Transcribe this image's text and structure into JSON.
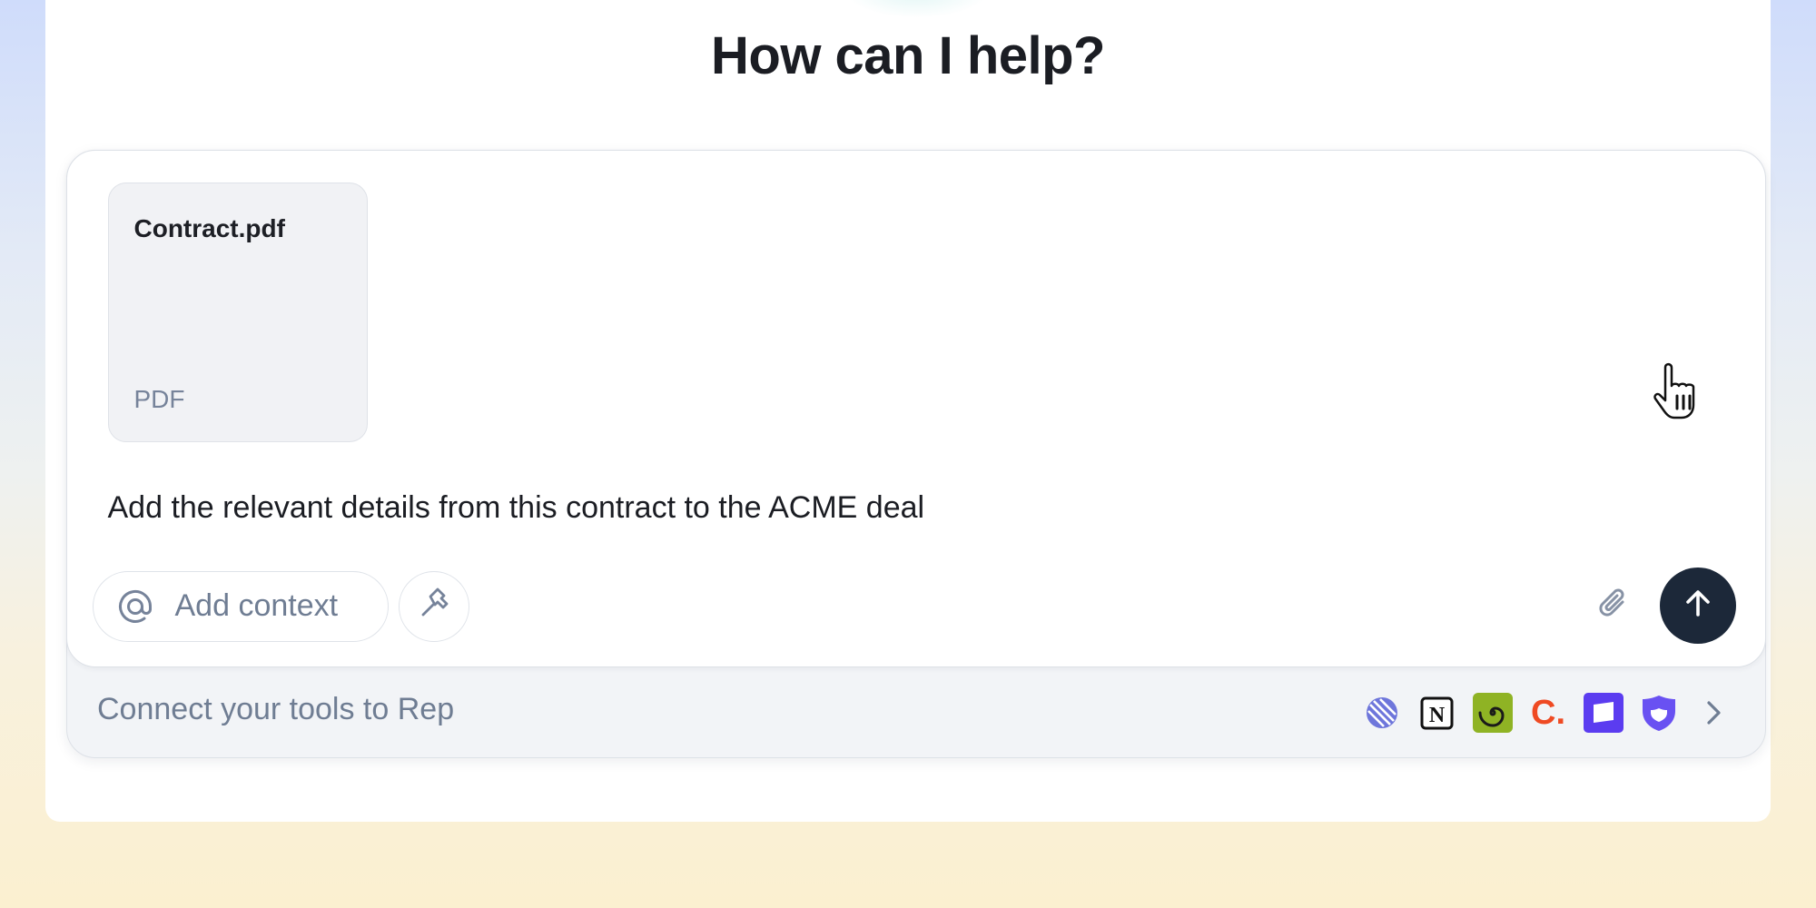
{
  "page": {
    "title": "How can I help?"
  },
  "composer": {
    "attachment": {
      "name": "Contract.pdf",
      "type": "PDF"
    },
    "prompt": "Add the relevant details from this contract to the ACME deal",
    "context_button": {
      "label": "Add context",
      "icon": "at-sign-icon"
    },
    "tools_button": {
      "icon": "hammer-icon"
    },
    "attach_button": {
      "icon": "paperclip-icon"
    },
    "send_button": {
      "icon": "arrow-up-icon",
      "color": "#1c2839"
    }
  },
  "connect": {
    "label": "Connect your tools to Rep",
    "tools": [
      {
        "name": "linear-icon",
        "color": "#6e76db"
      },
      {
        "name": "notion-icon",
        "color": "#111111"
      },
      {
        "name": "spiral-icon",
        "color": "#8fb324"
      },
      {
        "name": "c-brand-icon",
        "color": "#ef4a23",
        "text": "C."
      },
      {
        "name": "intercom-icon",
        "color": "#5b3cf0"
      },
      {
        "name": "shield-icon",
        "color": "#6951f2"
      }
    ],
    "more_icon": "chevron-right-icon"
  },
  "colors": {
    "accent_dark": "#1c2839",
    "muted_text": "#6f7d93"
  }
}
